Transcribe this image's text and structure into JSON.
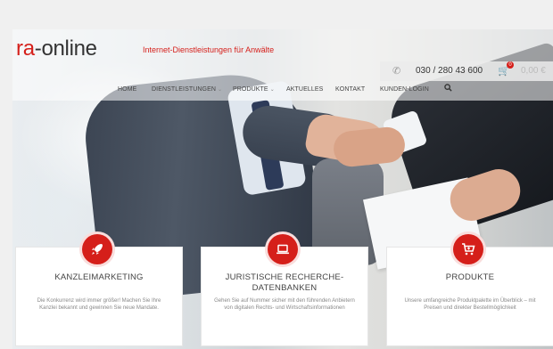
{
  "header": {
    "logo_prefix": "ra",
    "logo_suffix": "-online",
    "tagline": "Internet-Dienstleistungen für Anwälte",
    "phone": "030 / 280 43 600",
    "cart_count": "0",
    "cart_total": "0,00 €"
  },
  "nav": {
    "items": [
      {
        "label": "HOME"
      },
      {
        "label": "DIENSTLEISTUNGEN"
      },
      {
        "label": "PRODUKTE"
      },
      {
        "label": "AKTUELLES"
      },
      {
        "label": "KONTAKT"
      },
      {
        "label": "KUNDEN-LOGIN"
      }
    ]
  },
  "cards": [
    {
      "title": "KANZLEIMARKETING",
      "text": "Die Konkurrenz wird immer größer! Machen Sie Ihre Kanzlei bekannt und gewinnen Sie neue Mandate.",
      "icon": "rocket-icon"
    },
    {
      "title": "JURISTISCHE RECHERCHE-DATENBANKEN",
      "text": "Gehen Sie auf Nummer sicher mit den führenden Anbietern von digitalen Rechts- und Wirtschaftsinformationen",
      "icon": "laptop-icon"
    },
    {
      "title": "PRODUKTE",
      "text": "Unsere umfangreiche Produktpalette im Überblick – mit Preisen und direkter Bestellmöglichkeit",
      "icon": "cart-icon"
    }
  ],
  "colors": {
    "brand_red": "#d51f1a"
  }
}
